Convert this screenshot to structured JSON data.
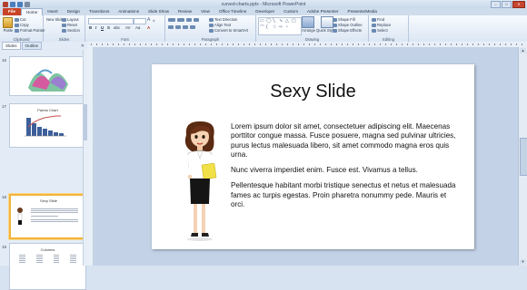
{
  "window": {
    "title": "curved-charts.pptx - Microsoft PowerPoint"
  },
  "tabs": [
    "File",
    "Home",
    "Insert",
    "Design",
    "Transitions",
    "Animations",
    "Slide Show",
    "Review",
    "View",
    "Office Timeline",
    "Developer",
    "Custom",
    "Adobe Presenter",
    "PresenterMedia"
  ],
  "ribbon": {
    "clipboard": {
      "label": "Clipboard",
      "paste": "Paste",
      "cut": "Cut",
      "copy": "Copy",
      "format_painter": "Format Painter"
    },
    "slides": {
      "label": "Slides",
      "new_slide": "New Slide",
      "layout": "Layout",
      "reset": "Reset",
      "section": "Section"
    },
    "font": {
      "label": "Font"
    },
    "paragraph": {
      "label": "Paragraph",
      "text_direction": "Text Direction",
      "align_text": "Align Text",
      "convert_smartart": "Convert to SmartArt"
    },
    "drawing": {
      "label": "Drawing",
      "arrange": "Arrange",
      "quick_styles": "Quick Styles",
      "shape_fill": "Shape Fill",
      "shape_outline": "Shape Outline",
      "shape_effects": "Shape Effects"
    },
    "editing": {
      "label": "Editing",
      "find": "Find",
      "replace": "Replace",
      "select": "Select"
    }
  },
  "pane": {
    "tabs": [
      "Slides",
      "Outline"
    ],
    "thumbnails": [
      {
        "number": "16",
        "title": ""
      },
      {
        "number": "17",
        "title": "Pareto Chart"
      },
      {
        "number": "18",
        "title": "Sexy Slide"
      },
      {
        "number": "19",
        "title": "Columns"
      }
    ]
  },
  "slide": {
    "title": "Sexy Slide",
    "paragraphs": [
      "Lorem ipsum dolor sit amet, consectetuer adipiscing elit. Maecenas porttitor congue massa. Fusce posuere, magna sed pulvinar ultricies, purus lectus malesuada libero, sit amet commodo magna eros quis urna.",
      "Nunc viverra imperdiet enim. Fusce est. Vivamus a tellus.",
      "Pellentesque habitant morbi tristique senectus et netus et malesuada fames ac turpis egestas. Proin pharetra nonummy pede. Mauris et orci."
    ]
  },
  "colors": {
    "file_tab": "#c94426",
    "ribbon": "#dce7f4",
    "selection": "#f2b43a"
  }
}
